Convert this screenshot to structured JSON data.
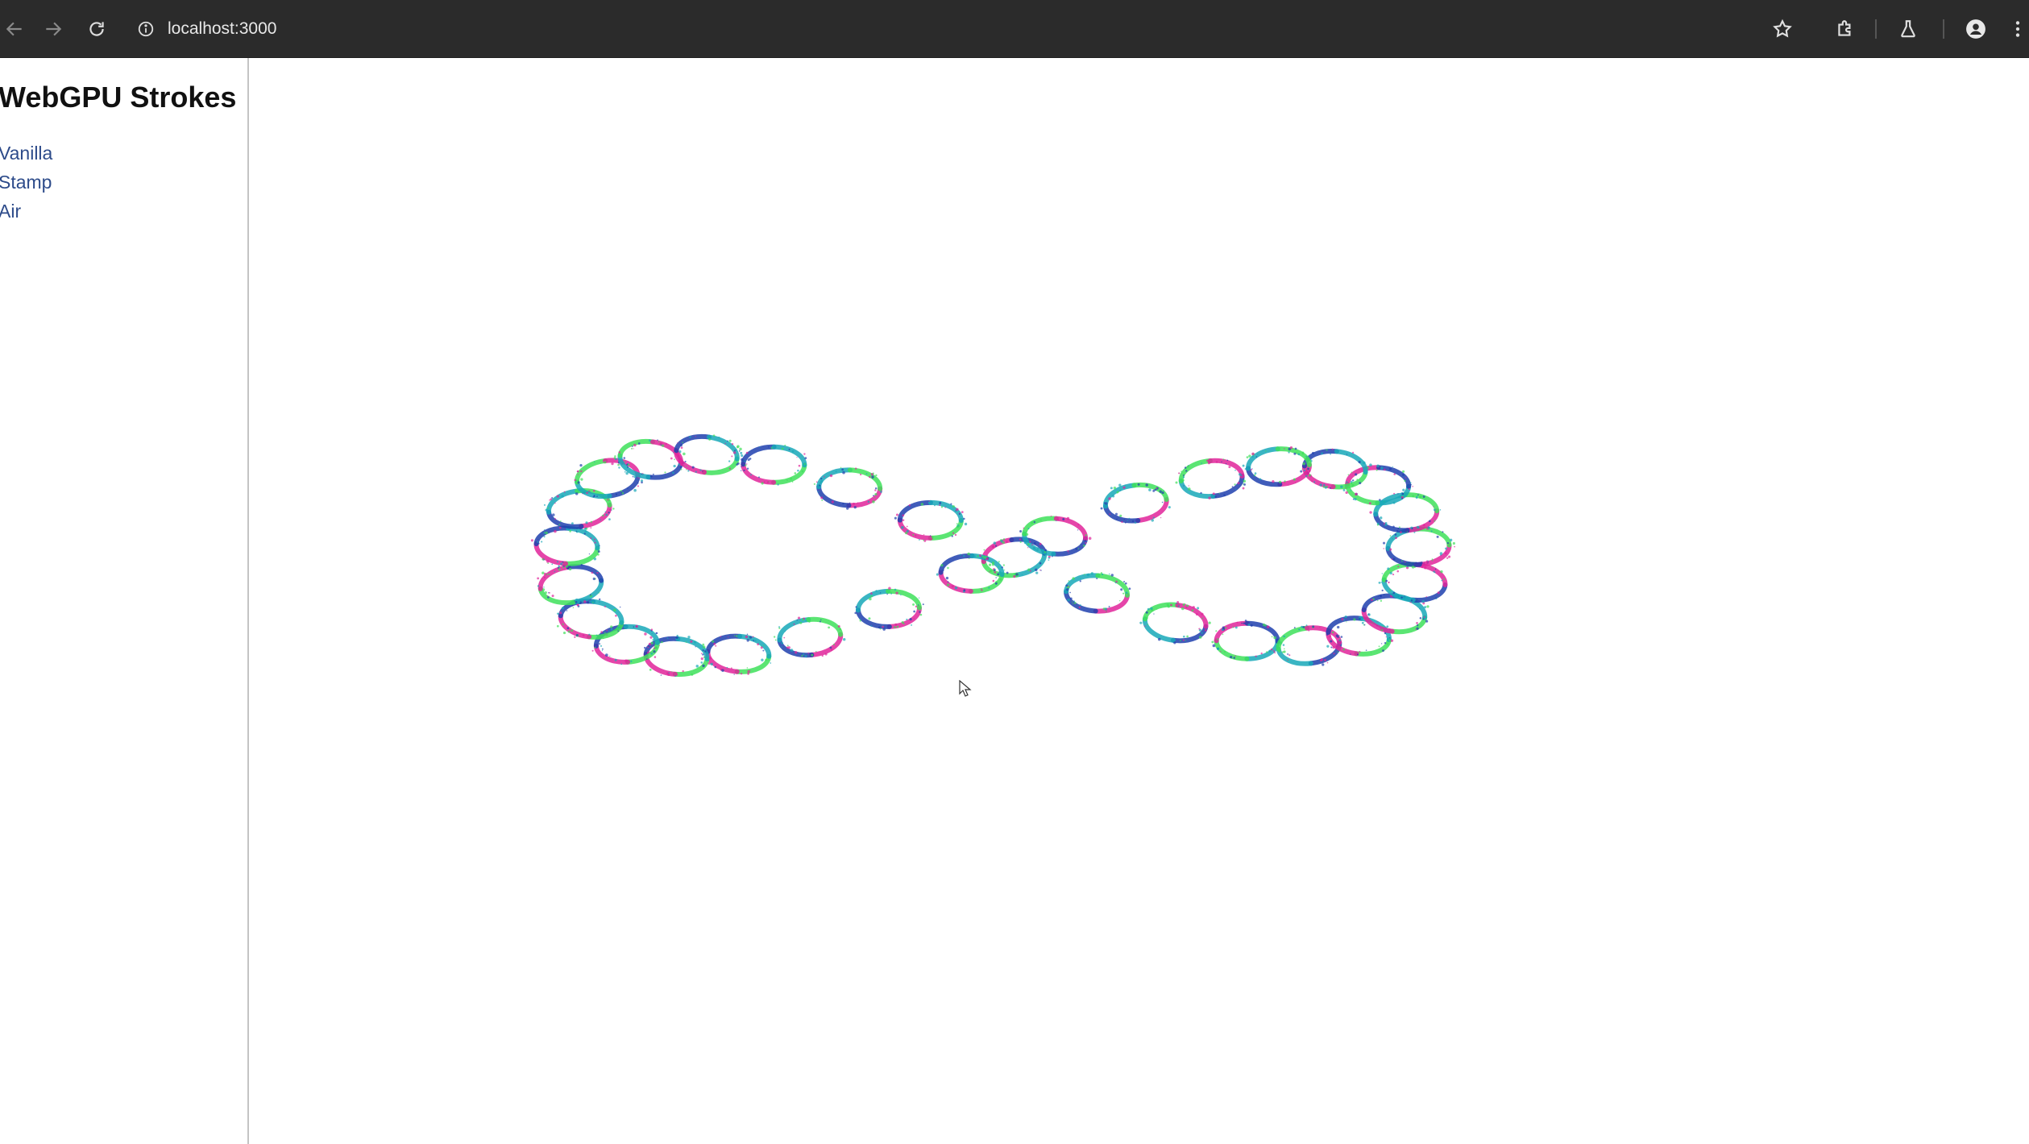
{
  "browser": {
    "url": "localhost:3000",
    "icons": {
      "back": "back-arrow-icon",
      "forward": "forward-arrow-icon",
      "reload": "reload-icon",
      "site_info": "info-icon",
      "bookmark": "star-icon",
      "extensions": "puzzle-icon",
      "labs": "flask-icon",
      "profile": "person-icon",
      "menu": "kebab-menu-icon"
    }
  },
  "sidebar": {
    "title": "WebGPU Strokes",
    "links": [
      {
        "label": "Vanilla"
      },
      {
        "label": "Stamp"
      },
      {
        "label": "Air"
      }
    ]
  },
  "canvas": {
    "shape": "figure-eight stroke made of stamped ellipses",
    "stamp_colors": [
      "#3ee05a",
      "#e0259a",
      "#1f3fae",
      "#18a8b8"
    ]
  }
}
